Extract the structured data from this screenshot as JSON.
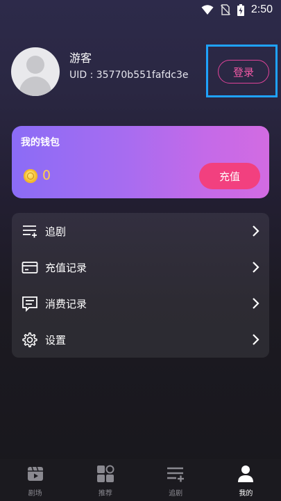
{
  "status_bar": {
    "time": "2:50"
  },
  "profile": {
    "nickname": "游客",
    "uid": "UID : 35770b551fafdc3e",
    "login_label": "登录"
  },
  "wallet": {
    "title": "我的钱包",
    "balance": "0",
    "recharge_label": "充值"
  },
  "menu": {
    "items": [
      {
        "label": "追剧",
        "icon": "follow-list-icon"
      },
      {
        "label": "充值记录",
        "icon": "card-icon"
      },
      {
        "label": "消费记录",
        "icon": "receipt-icon"
      },
      {
        "label": "设置",
        "icon": "gear-icon"
      }
    ]
  },
  "tabbar": {
    "tabs": [
      {
        "label": "剧场",
        "icon": "clapperboard-icon",
        "active": false
      },
      {
        "label": "推荐",
        "icon": "grid-icon",
        "active": false
      },
      {
        "label": "追剧",
        "icon": "follow-list-icon",
        "active": false
      },
      {
        "label": "我的",
        "icon": "user-icon",
        "active": true
      }
    ]
  },
  "colors": {
    "accent": "#f2407f",
    "login_text": "#f35aa6",
    "balance": "#ffcf4a",
    "highlight": "#1fa3ff"
  }
}
